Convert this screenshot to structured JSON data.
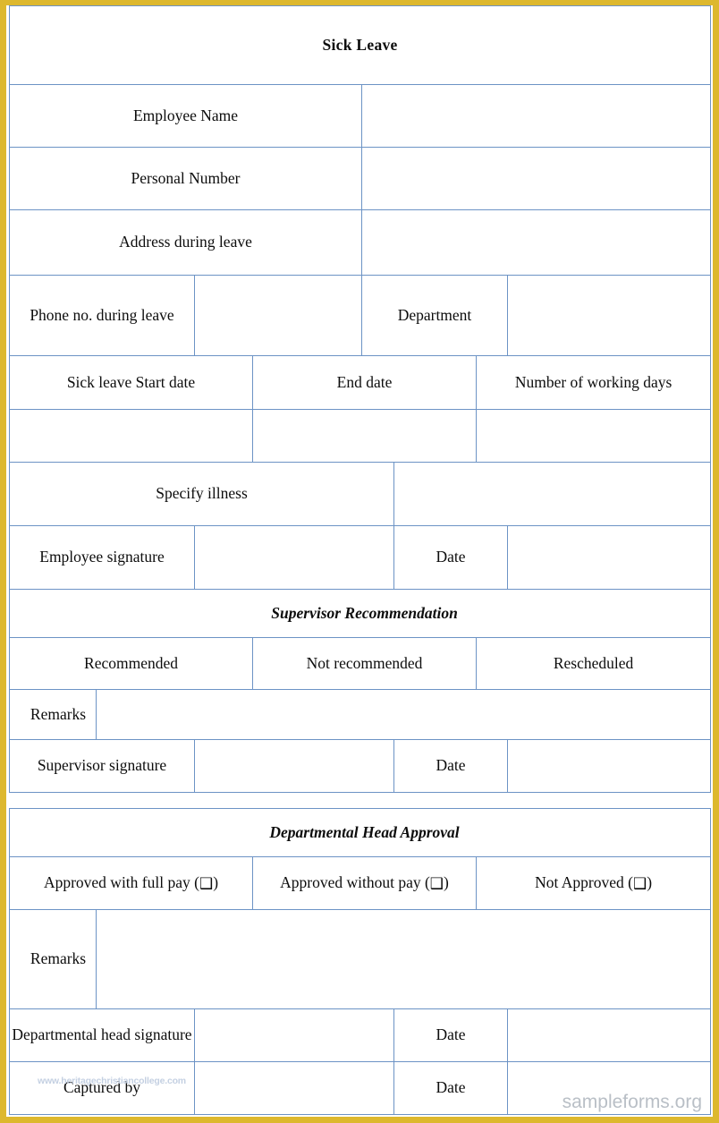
{
  "document": {
    "title": "Sick Leave",
    "border_color": "#ddb82e",
    "header_color": "#4f81bd",
    "cell_blue": "#dbe5f1",
    "grid_color": "#6c93c5"
  },
  "employee_section": {
    "employee_name_label": "Employee Name",
    "personal_number_label": "Personal Number",
    "address_label": "Address during leave",
    "phone_label": "Phone no. during leave",
    "department_label": "Department",
    "start_date_label": "Sick leave Start date",
    "end_date_label": "End date",
    "working_days_label": "Number of working days",
    "specify_illness_label": "Specify illness",
    "employee_signature_label": "Employee signature",
    "employee_date_label": "Date",
    "employee_name_value": "",
    "personal_number_value": "",
    "address_value": "",
    "phone_value": "",
    "department_value": "",
    "start_date_value": "",
    "end_date_value": "",
    "working_days_value": "",
    "specify_illness_value": "",
    "employee_signature_value": "",
    "employee_date_value": ""
  },
  "supervisor_section": {
    "heading": "Supervisor Recommendation",
    "recommended_label": "Recommended",
    "not_recommended_label": "Not recommended",
    "rescheduled_label": "Rescheduled",
    "remarks_label": "Remarks",
    "remarks_value": "",
    "signature_label": "Supervisor signature",
    "signature_value": "",
    "date_label": "Date",
    "date_value": ""
  },
  "department_head_section": {
    "heading": "Departmental Head Approval",
    "approved_full_pay_label": "Approved with full pay (",
    "approved_without_pay_label": "Approved without pay (",
    "not_approved_label": "Not Approved (",
    "checkbox_glyph": "❑",
    "paren_close": ")",
    "remarks_label": "Remarks",
    "remarks_value": "",
    "signature_label": "Departmental head signature",
    "signature_value": "",
    "signature_date_label": "Date",
    "signature_date_value": "",
    "captured_by_label": "Captured by",
    "captured_by_value": "",
    "captured_date_label": "Date",
    "captured_date_value": ""
  },
  "watermarks": {
    "left": "www.heritagechristiancollege.com",
    "right": "sampleforms.org"
  }
}
